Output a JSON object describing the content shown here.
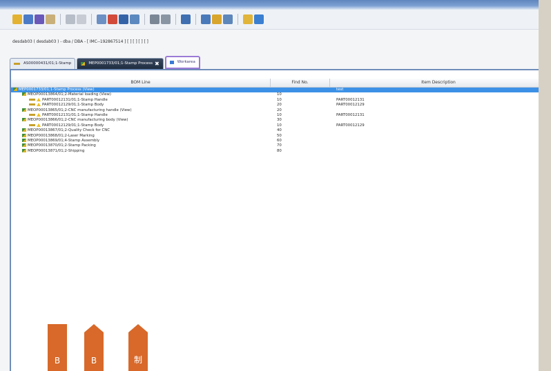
{
  "path": "desdab03 ( desdab03 ) - dba / DBA - [ IMC--192867514 ] [ ] [ ] [ ] [ ]",
  "tabs": [
    {
      "label": "AS00000431/01;1-Stamp"
    },
    {
      "label": "MEP0001733/01;1-Stamp Process",
      "close": "✖"
    },
    {
      "label": "Workarea"
    }
  ],
  "columns": [
    "BOM Line",
    "Find No.",
    "Item Description"
  ],
  "rows": [
    {
      "label": "MEP0001733/01;1-Stamp Process (View)",
      "find": "",
      "desc": "test",
      "indent": 0,
      "selected": true
    },
    {
      "label": "MEOP00013864/01;2-Material loading (View)",
      "find": "10",
      "desc": "",
      "indent": 1
    },
    {
      "label": "PART00012131/01;1-Stamp Handle",
      "find": "10",
      "desc": "PART00012131",
      "indent": 2
    },
    {
      "label": "PART00012129/01;1-Stamp Body",
      "find": "20",
      "desc": "PART00012129",
      "indent": 2
    },
    {
      "label": "MEOP00013865/01;2-CNC manufacturing handle (View)",
      "find": "20",
      "desc": "",
      "indent": 1
    },
    {
      "label": "PART00012131/01;1-Stamp Handle",
      "find": "10",
      "desc": "PART00012131",
      "indent": 2
    },
    {
      "label": "MEOP00013866/01;2-CNC manufacturing body (View)",
      "find": "30",
      "desc": "",
      "indent": 1
    },
    {
      "label": "PART00012129/01;1-Stamp Body",
      "find": "10",
      "desc": "PART00012129",
      "indent": 2
    },
    {
      "label": "MEOP00013867/01;2-Quality Check for CNC",
      "find": "40",
      "desc": "",
      "indent": 1
    },
    {
      "label": "MEOP00013868/01;2-Laser Marking",
      "find": "50",
      "desc": "",
      "indent": 1
    },
    {
      "label": "MEOP00013869/01;4-Stamp Assembly",
      "find": "60",
      "desc": "",
      "indent": 1
    },
    {
      "label": "MEOP00013870/01;2-Stamp Packing",
      "find": "70",
      "desc": "",
      "indent": 1
    },
    {
      "label": "MEOP00013871/01;2-Shipping",
      "find": "80",
      "desc": "",
      "indent": 1
    }
  ],
  "ribbons": [
    "B",
    "B",
    "制"
  ]
}
